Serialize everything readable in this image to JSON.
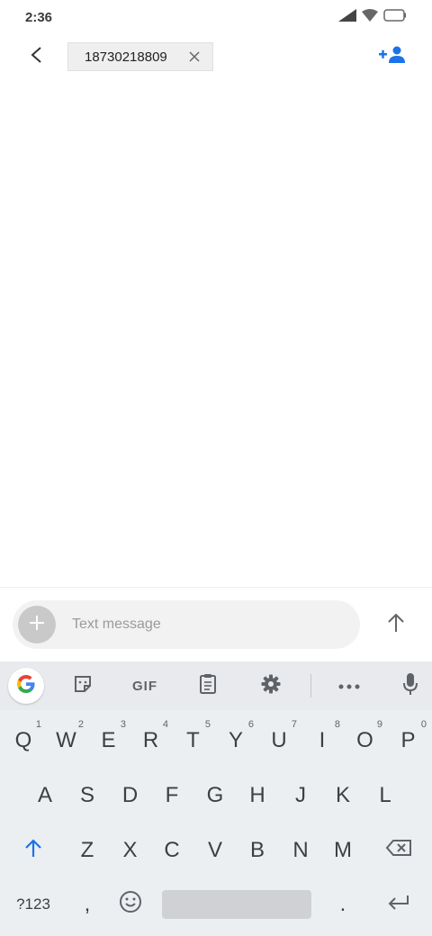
{
  "status_bar": {
    "time": "2:36",
    "icons": [
      "signal-icon",
      "wifi-icon",
      "battery-icon"
    ]
  },
  "app_bar": {
    "back_icon": "arrow-back-icon",
    "recipient": "18730218809",
    "chip_close_icon": "close-icon",
    "add_contact_icon": "person-add-icon",
    "accent_color": "#1a73e8"
  },
  "composer": {
    "placeholder": "Text message",
    "attach_icon": "plus-icon",
    "send_icon": "arrow-up-icon"
  },
  "keyboard": {
    "toolbar": {
      "items": [
        "google-icon",
        "sticker-icon",
        "GIF",
        "clipboard-icon",
        "gear-icon",
        "more-icon",
        "mic-icon"
      ],
      "gif_label": "GIF"
    },
    "row1": [
      {
        "key": "Q",
        "hint": "1"
      },
      {
        "key": "W",
        "hint": "2"
      },
      {
        "key": "E",
        "hint": "3"
      },
      {
        "key": "R",
        "hint": "4"
      },
      {
        "key": "T",
        "hint": "5"
      },
      {
        "key": "Y",
        "hint": "6"
      },
      {
        "key": "U",
        "hint": "7"
      },
      {
        "key": "I",
        "hint": "8"
      },
      {
        "key": "O",
        "hint": "9"
      },
      {
        "key": "P",
        "hint": "0"
      }
    ],
    "row2": [
      "A",
      "S",
      "D",
      "F",
      "G",
      "H",
      "J",
      "K",
      "L"
    ],
    "row3": [
      "Z",
      "X",
      "C",
      "V",
      "B",
      "N",
      "M"
    ],
    "row4": {
      "symbols": "?123",
      "comma": ",",
      "period": ".",
      "emoji_icon": "emoji-icon",
      "enter_icon": "enter-icon"
    },
    "shift_icon": "shift-icon",
    "backspace_icon": "backspace-icon"
  }
}
